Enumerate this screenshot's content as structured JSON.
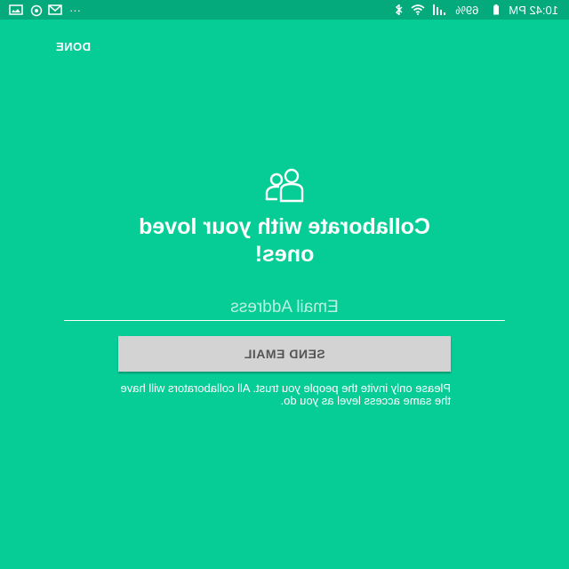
{
  "status_bar": {
    "time": "10:42 PM",
    "battery": "69%",
    "overflow": "···",
    "icons": [
      "battery-icon",
      "signal-icon",
      "wifi-icon",
      "bluetooth-icon",
      "mail-icon",
      "whatsapp-icon",
      "image-icon"
    ]
  },
  "toolbar": {
    "done_label": "DONE"
  },
  "hero": {
    "icon": "people-icon",
    "headline": "Collaborate with your loved ones!"
  },
  "form": {
    "email_placeholder": "Email Address",
    "send_label": "SEND EMAIL",
    "note": "Please only invite the people you trust. All collaborators will have the same access level as you do."
  },
  "colors": {
    "background": "#06CC96",
    "status_bar": "#04A97C",
    "button": "#D3D3D3",
    "button_text": "#555555"
  }
}
